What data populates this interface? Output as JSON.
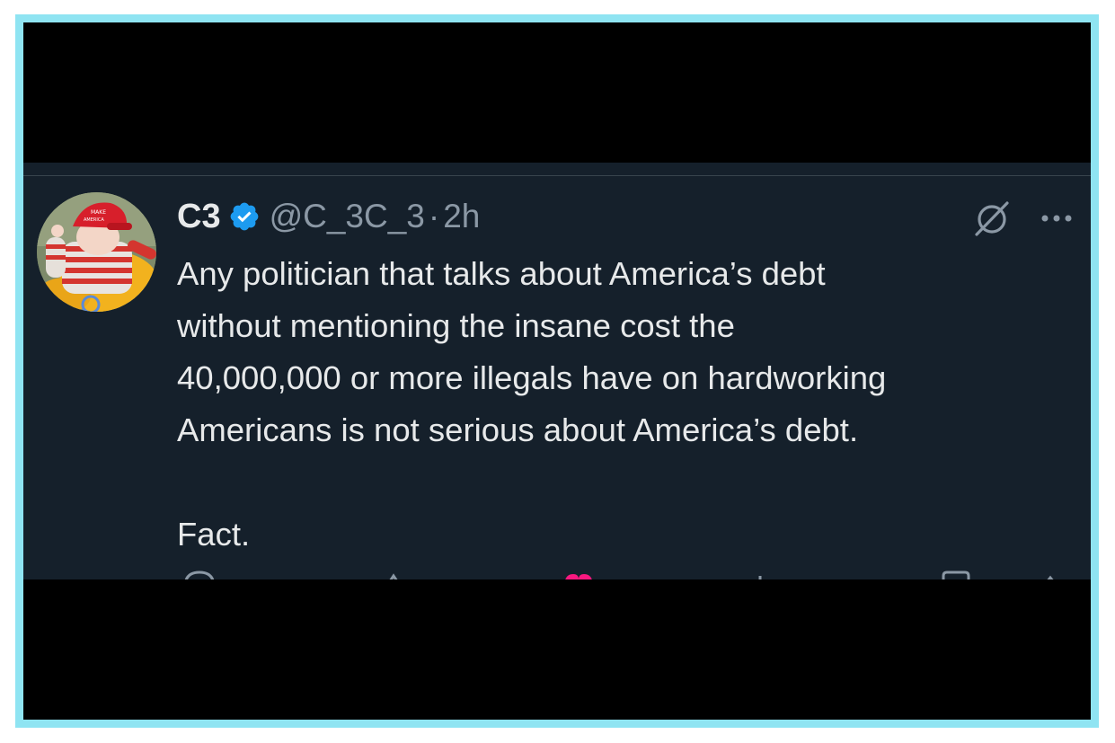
{
  "tweet": {
    "display_name": "C3",
    "handle": "@C_3C_3",
    "separator": "·",
    "timestamp": "2h",
    "body": "Any politician that talks about America’s debt\nwithout mentioning the insane cost the\n40,000,000 or more illegals have on hardworking\nAmericans is not serious about America’s debt.",
    "closing": "Fact.",
    "verified": true
  },
  "icons": {
    "verified": "verified-badge-icon",
    "grok": "grok-icon",
    "more": "more-options-icon",
    "reply": "reply-icon",
    "retweet": "retweet-icon",
    "like": "like-icon",
    "views": "views-icon",
    "bookmark": "bookmark-icon",
    "share": "share-icon"
  },
  "colors": {
    "panel_bg": "#15202b",
    "text_primary": "#e7e9ea",
    "text_secondary": "#8b98a5",
    "verified_blue": "#1d9bf0",
    "like_pink": "#f91880",
    "frame_border": "#8fe4f2"
  }
}
